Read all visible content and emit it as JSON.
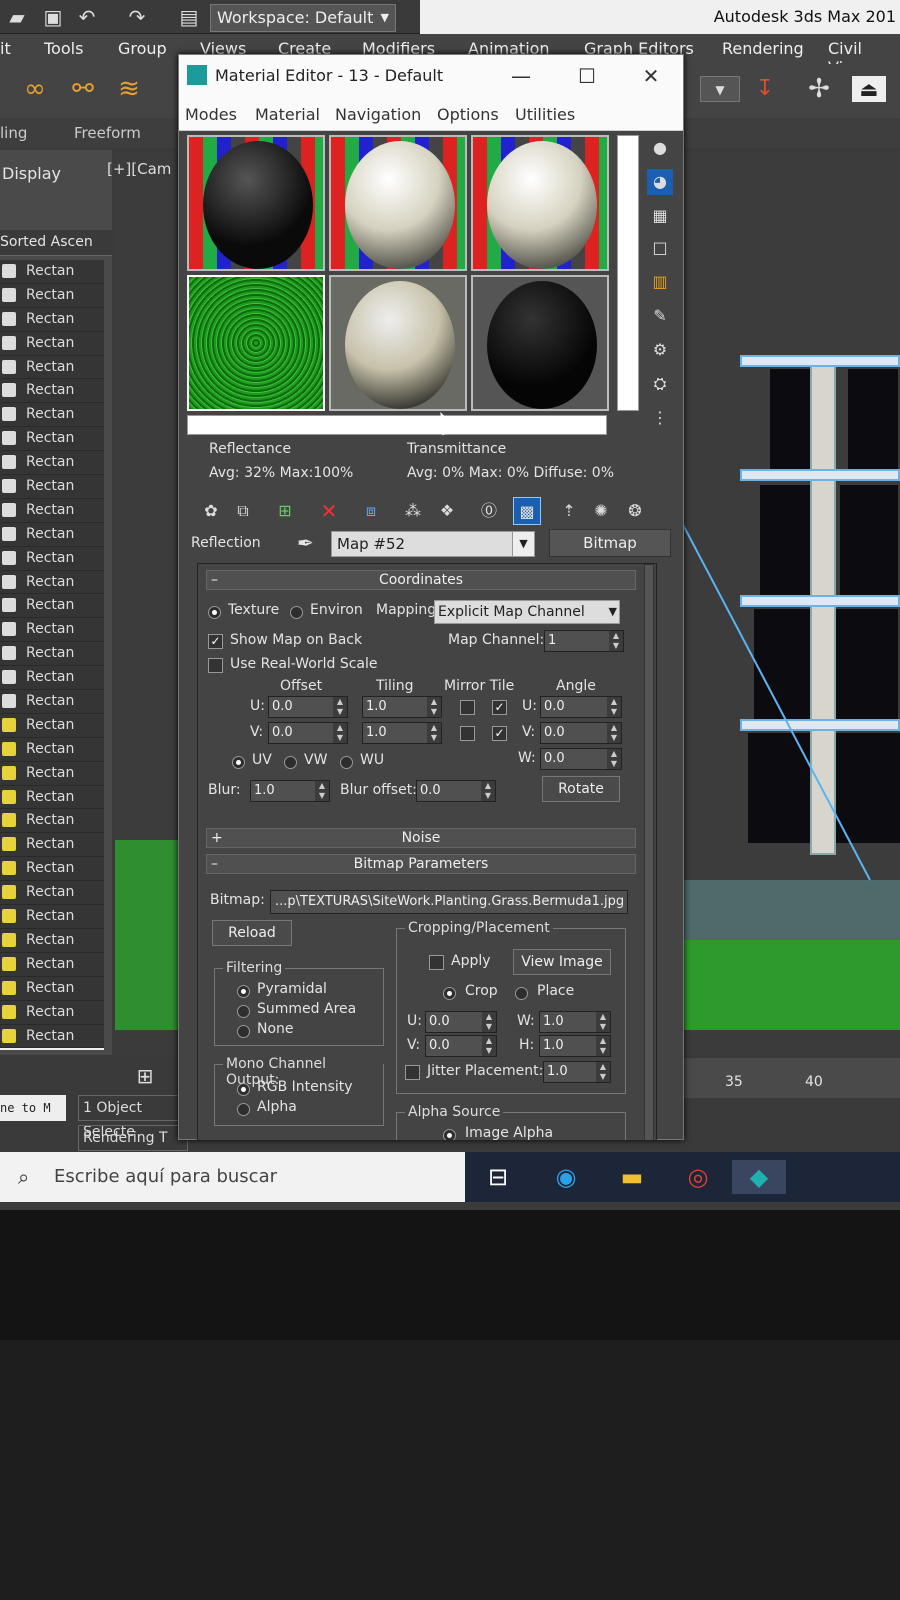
{
  "app_title": "Autodesk 3ds Max 201",
  "workspace": "Workspace: Default",
  "main_menu": [
    "it",
    "Tools",
    "Group",
    "Views",
    "Create",
    "Modifiers",
    "Animation",
    "Graph Editors",
    "Rendering",
    "Civil View"
  ],
  "ribbon": {
    "left": "ling",
    "freeform": "Freeform"
  },
  "scene_explorer": {
    "tab": "Display",
    "sort_header": "Sorted Ascen",
    "items": [
      "Rectan",
      "Rectan",
      "Rectan",
      "Rectan",
      "Rectan",
      "Rectan",
      "Rectan",
      "Rectan",
      "Rectan",
      "Rectan",
      "Rectan",
      "Rectan",
      "Rectan",
      "Rectan",
      "Rectan",
      "Rectan",
      "Rectan",
      "Rectan",
      "Rectan",
      "Rectan",
      "Rectan",
      "Rectan",
      "Rectan",
      "Rectan",
      "Rectan",
      "Rectan",
      "Rectan",
      "Rectan",
      "Rectan",
      "Rectan",
      "Rectan",
      "Rectan",
      "Rectan"
    ]
  },
  "viewport_label": "[+][Cam",
  "status": {
    "selected": "1 Object Selecte",
    "rendering": "Rendering T",
    "prompt": "ne to M"
  },
  "timeline_ticks": [
    "35",
    "40"
  ],
  "material_editor": {
    "title": "Material Editor - 13 - Default",
    "menu": [
      "Modes",
      "Material",
      "Navigation",
      "Options",
      "Utilities"
    ],
    "reflectance_label": "Reflectance",
    "reflectance_values": "Avg: 32% Max:100%",
    "transmittance_label": "Transmittance",
    "transmittance_values": "Avg:   0% Max:   0%  Diffuse:   0%",
    "reflection_label": "Reflection",
    "map_name": "Map #52",
    "map_type": "Bitmap",
    "coordinates": {
      "header": "Coordinates",
      "texture": "Texture",
      "environ": "Environ",
      "mapping_label": "Mapping:",
      "mapping_value": "Explicit Map Channel",
      "show_map_on_back": "Show Map on Back",
      "map_channel_label": "Map Channel:",
      "map_channel_value": "1",
      "use_real_world": "Use Real-World Scale",
      "offset": "Offset",
      "tiling": "Tiling",
      "mirror_tile": "Mirror Tile",
      "angle": "Angle",
      "u_label": "U:",
      "v_label": "V:",
      "w_label": "W:",
      "offset_u": "0.0",
      "offset_v": "0.0",
      "tiling_u": "1.0",
      "tiling_v": "1.0",
      "angle_u": "0.0",
      "angle_v": "0.0",
      "angle_w": "0.0",
      "uv": "UV",
      "vw": "VW",
      "wu": "WU",
      "blur_label": "Blur:",
      "blur_value": "1.0",
      "blur_offset_label": "Blur offset:",
      "blur_offset_value": "0.0",
      "rotate": "Rotate"
    },
    "noise_header": "Noise",
    "bitmap_params": {
      "header": "Bitmap Parameters",
      "bitmap_label": "Bitmap:",
      "bitmap_path": "...p\\TEXTURAS\\SiteWork.Planting.Grass.Bermuda1.jpg",
      "reload": "Reload",
      "cropping": "Cropping/Placement",
      "apply": "Apply",
      "view_image": "View Image",
      "crop": "Crop",
      "place": "Place",
      "u_label": "U:",
      "v_label": "V:",
      "w_label": "W:",
      "h_label": "H:",
      "crop_u": "0.0",
      "crop_v": "0.0",
      "crop_w": "1.0",
      "crop_h": "1.0",
      "jitter": "Jitter Placement:",
      "jitter_value": "1.0",
      "filtering": "Filtering",
      "pyramidal": "Pyramidal",
      "summed_area": "Summed Area",
      "none": "None",
      "mono_channel": "Mono Channel Output:",
      "rgb_intensity": "RGB Intensity",
      "alpha": "Alpha",
      "alpha_source": "Alpha Source",
      "image_alpha": "Image Alpha"
    }
  },
  "taskbar": {
    "search_placeholder": "Escribe aquí para buscar"
  },
  "colors": {
    "grass": "#2e9a2e",
    "accent_blue": "#6bb2e6",
    "taskbar": "#1d2638"
  }
}
